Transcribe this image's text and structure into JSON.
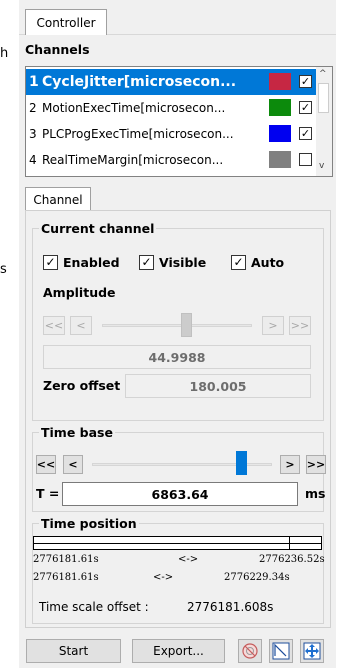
{
  "left_fragments": {
    "a": "h",
    "b": "s"
  },
  "tabs": {
    "controller": "Controller",
    "channel": "Channel"
  },
  "channels": {
    "title": "Channels",
    "rows": [
      {
        "num": "1",
        "name": "CycleJitter[microsecon...",
        "color": "#c62743",
        "checked": true,
        "selected": true
      },
      {
        "num": "2",
        "name": "MotionExecTime[microsecon...",
        "color": "#0c8a0c",
        "checked": true,
        "selected": false
      },
      {
        "num": "3",
        "name": "PLCProgExecTime[microsecon...",
        "color": "#0000f0",
        "checked": true,
        "selected": false
      },
      {
        "num": "4",
        "name": "RealTimeMargin[microsecon...",
        "color": "#808080",
        "checked": false,
        "selected": false
      }
    ]
  },
  "current_channel": {
    "title": "Current channel",
    "enabled": "Enabled",
    "visible": "Visible",
    "auto": "Auto",
    "amplitude_label": "Amplitude",
    "amplitude_value": "44.9988",
    "zero_offset_label": "Zero offset",
    "zero_offset_value": "180.005",
    "slider_position": 0.56
  },
  "time_base": {
    "title": "Time base",
    "t_label": "T =",
    "t_value": "6863.64",
    "unit": "ms",
    "slider_position": 0.75
  },
  "time_position": {
    "title": "Time position",
    "row1_left": "2776181.61s",
    "row1_mid": "<->",
    "row1_right": "2776236.52s",
    "row2_left": "2776181.61s",
    "row2_mid": "<->",
    "row2_right": "2776229.34s",
    "offset_label": "Time scale offset :",
    "offset_value": "2776181.608s"
  },
  "buttons": {
    "first": "<<",
    "prev": "<",
    "next": ">",
    "last": ">>",
    "start": "Start",
    "export": "Export..."
  },
  "icons": [
    "record-icon",
    "autoscale-icon",
    "move-icon"
  ]
}
